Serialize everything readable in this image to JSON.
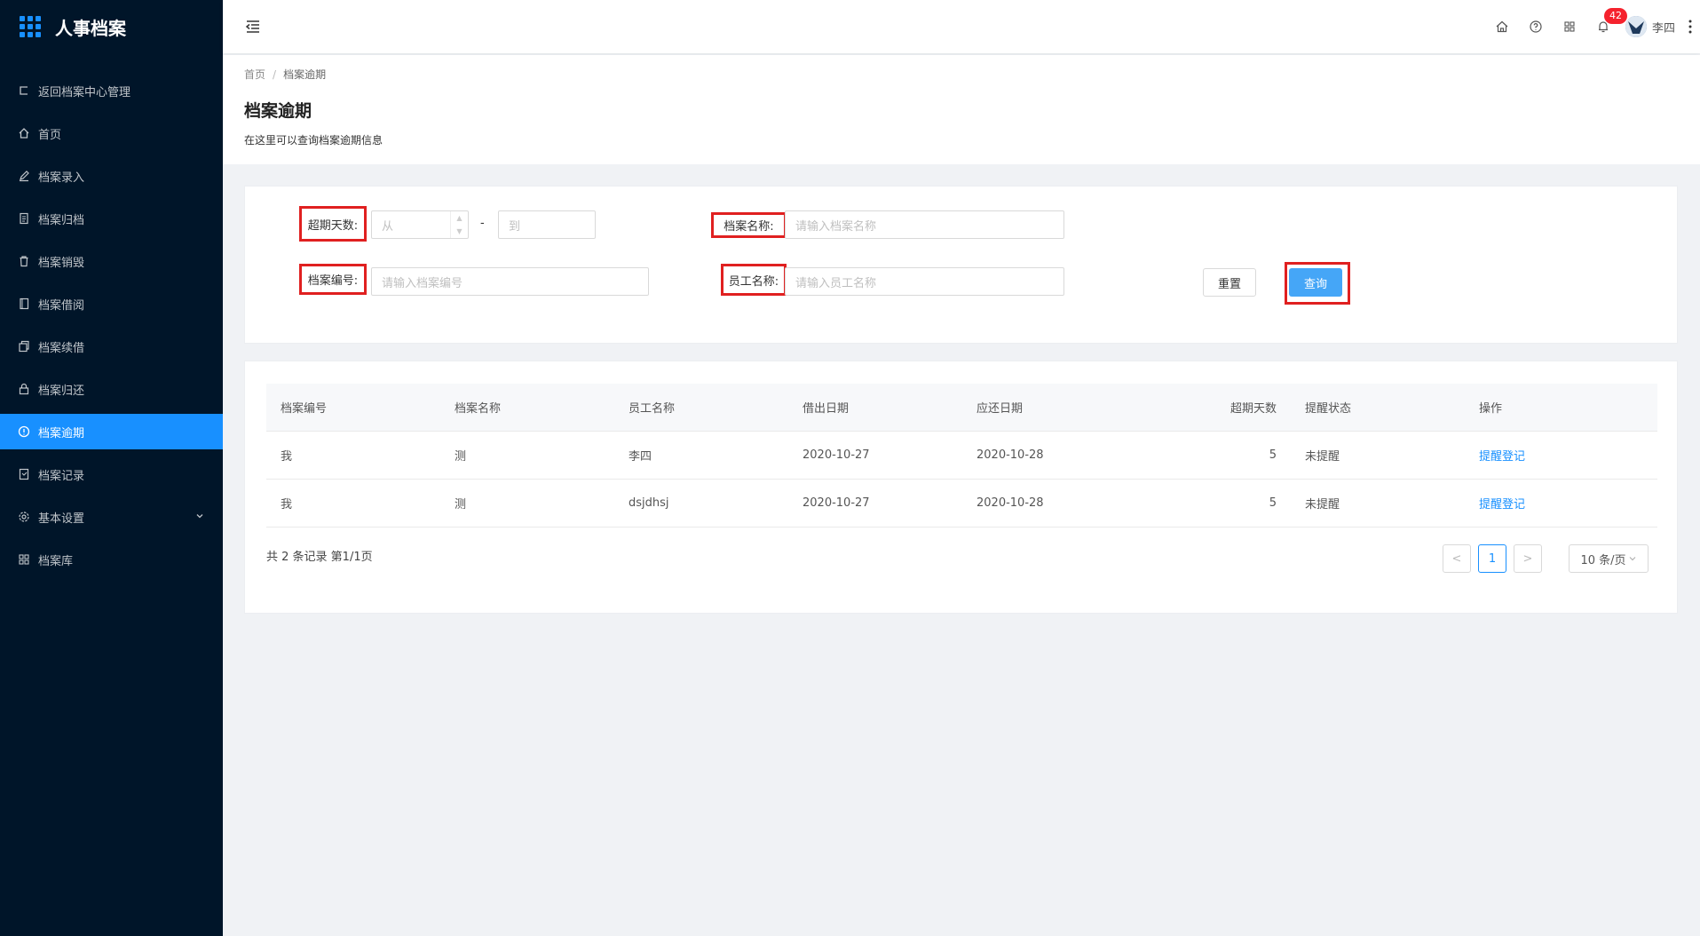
{
  "app": {
    "title": "人事档案"
  },
  "sidebar": {
    "items": [
      {
        "label": "返回档案中心管理",
        "icon": "return-icon"
      },
      {
        "label": "首页",
        "icon": "home-icon"
      },
      {
        "label": "档案录入",
        "icon": "edit-icon"
      },
      {
        "label": "档案归档",
        "icon": "file-icon"
      },
      {
        "label": "档案销毁",
        "icon": "delete-icon"
      },
      {
        "label": "档案借阅",
        "icon": "book-icon"
      },
      {
        "label": "档案续借",
        "icon": "copy-icon"
      },
      {
        "label": "档案归还",
        "icon": "lock-icon"
      },
      {
        "label": "档案逾期",
        "icon": "exclamation-circle-icon",
        "active": true
      },
      {
        "label": "档案记录",
        "icon": "record-icon"
      },
      {
        "label": "基本设置",
        "icon": "setting-icon",
        "expandable": true
      },
      {
        "label": "档案库",
        "icon": "appstore-icon"
      }
    ]
  },
  "header": {
    "notification_count": "42",
    "user_name": "李四"
  },
  "breadcrumb": {
    "home": "首页",
    "current": "档案逾期",
    "separator": "/"
  },
  "page": {
    "title": "档案逾期",
    "description": "在这里可以查询档案逾期信息"
  },
  "search": {
    "overdue_days_label": "超期天数:",
    "from_placeholder": "从",
    "range_separator": "-",
    "to_placeholder": "到",
    "archive_name_label": "档案名称:",
    "archive_name_placeholder": "请输入档案名称",
    "archive_no_label": "档案编号:",
    "archive_no_placeholder": "请输入档案编号",
    "employee_name_label": "员工名称:",
    "employee_name_placeholder": "请输入员工名称",
    "reset_label": "重置",
    "query_label": "查询"
  },
  "table": {
    "columns": [
      "档案编号",
      "档案名称",
      "员工名称",
      "借出日期",
      "应还日期",
      "超期天数",
      "提醒状态",
      "操作"
    ],
    "rows": [
      {
        "archive_no": "我",
        "archive_name": "测",
        "employee": "李四",
        "lend_date": "2020-10-27",
        "due_date": "2020-10-28",
        "overdue_days": "5",
        "remind_status": "未提醒",
        "action": "提醒登记"
      },
      {
        "archive_no": "我",
        "archive_name": "测",
        "employee": "dsjdhsj",
        "lend_date": "2020-10-27",
        "due_date": "2020-10-28",
        "overdue_days": "5",
        "remind_status": "未提醒",
        "action": "提醒登记"
      }
    ]
  },
  "pagination": {
    "summary": "共 2 条记录 第1/1页",
    "current_page": "1",
    "prev": "<",
    "next": ">",
    "page_size": "10 条/页"
  },
  "colors": {
    "primary": "#1890ff",
    "sidebar_bg": "#001529",
    "highlight_border": "#e02020"
  }
}
